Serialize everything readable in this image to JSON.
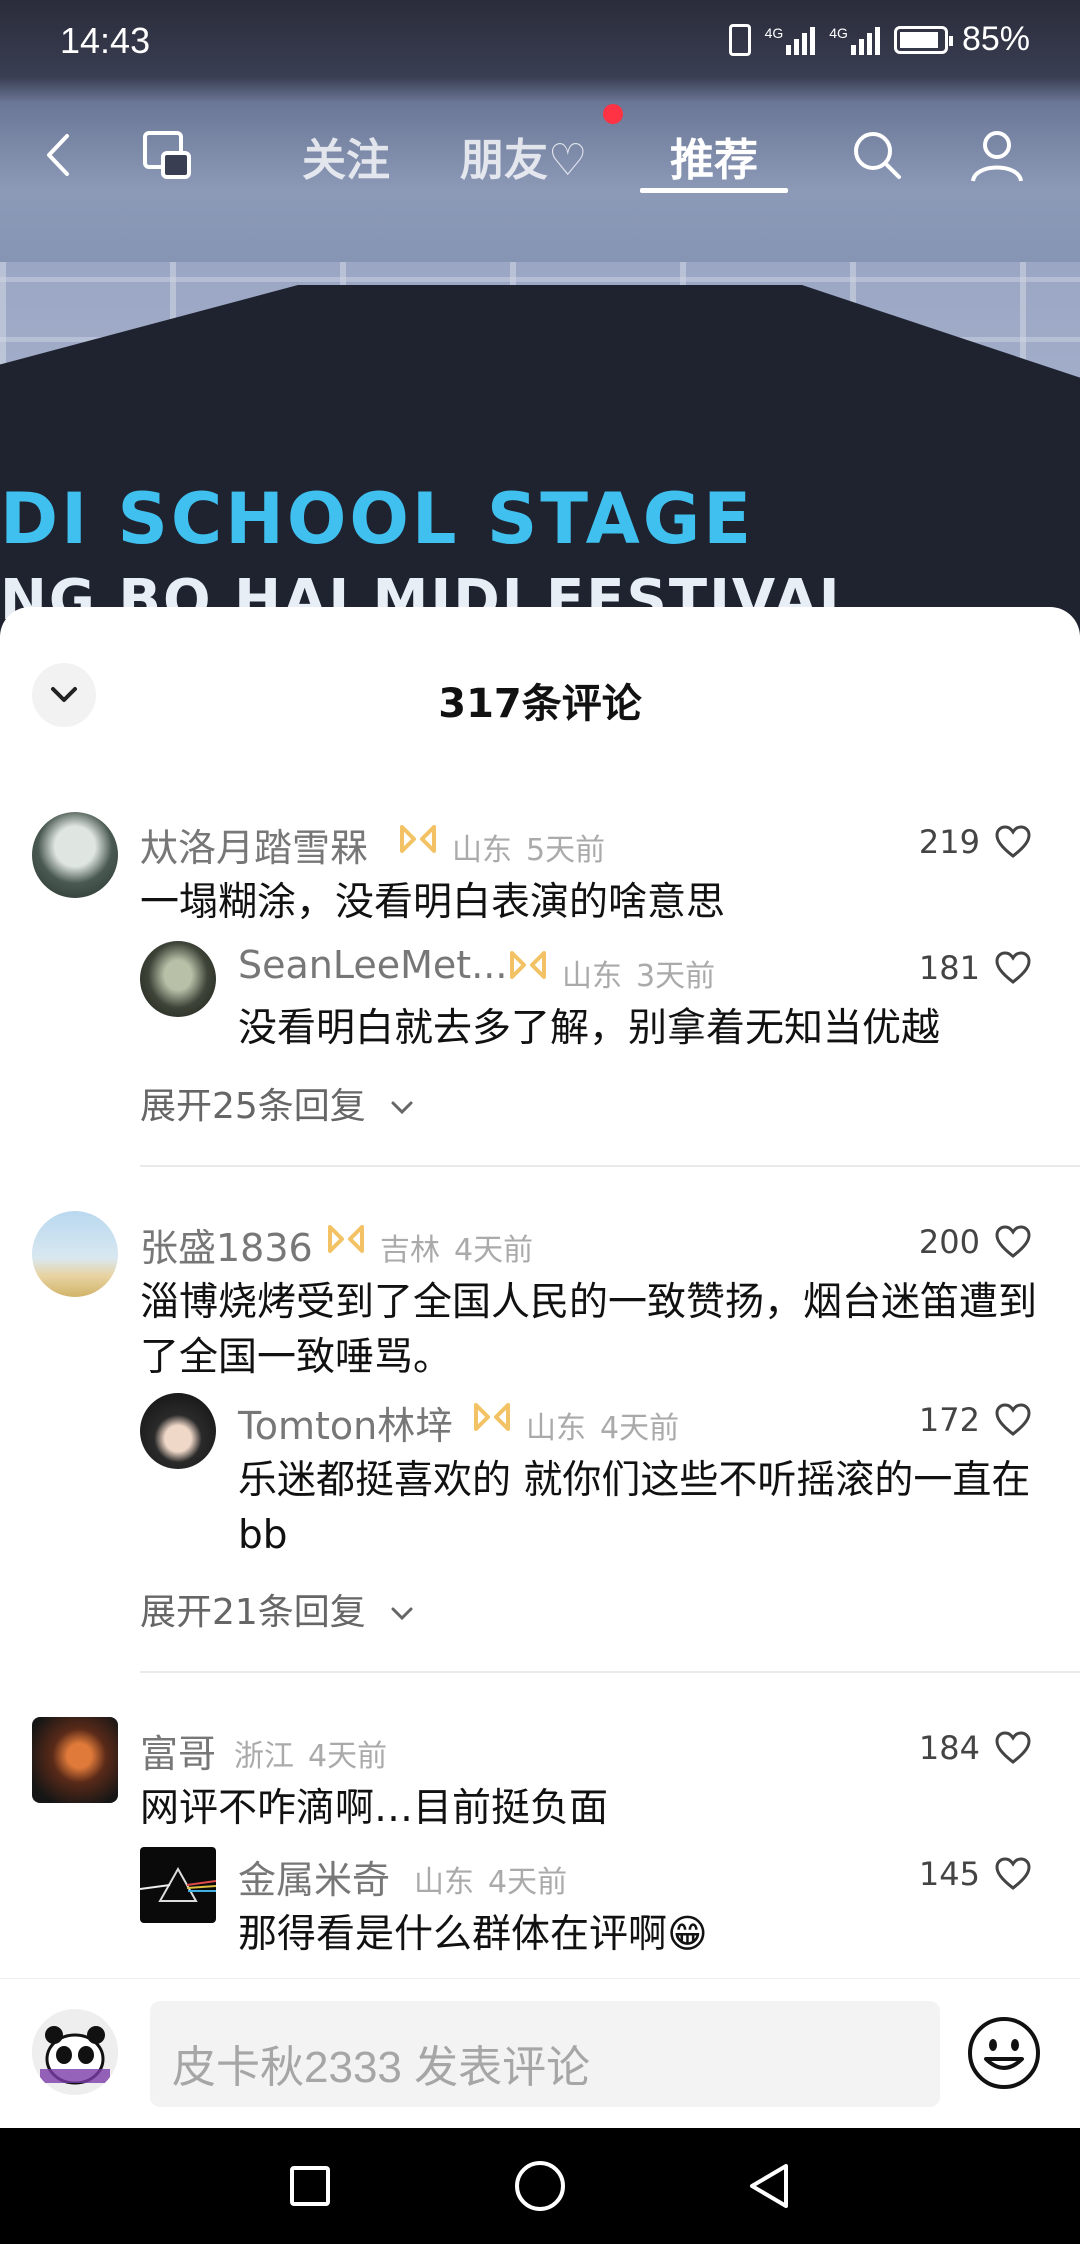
{
  "status_bar": {
    "time": "14:43",
    "network_1": "4G",
    "network_2": "4G",
    "battery": "85%"
  },
  "top_nav": {
    "tabs": [
      {
        "label": "关注"
      },
      {
        "label": "朋友♡"
      },
      {
        "label": "推荐",
        "active": true
      }
    ]
  },
  "video": {
    "text_line1": "DI SCHOOL STAGE",
    "text_line2": "NG BO HAI MIDI FESTIVAL"
  },
  "comments_sheet": {
    "title": "317条评论",
    "threads": [
      {
        "user": "夶洛月踏雪槑",
        "region": "山东",
        "time": "5天前",
        "likes": "219",
        "text": "一塌糊涂，没看明白表演的啥意思",
        "reply": {
          "user": "SeanLeeMet...",
          "region": "山东",
          "time": "3天前",
          "likes": "181",
          "text": "没看明白就去多了解，别拿着无知当优越"
        },
        "expand": "展开25条回复"
      },
      {
        "user": "张盛1836",
        "region": "吉林",
        "time": "4天前",
        "likes": "200",
        "text": "淄博烧烤受到了全国人民的一致赞扬，烟台迷笛遭到了全国一致唾骂。",
        "reply": {
          "user": "Tomton林垶",
          "region": "山东",
          "time": "4天前",
          "likes": "172",
          "text": "乐迷都挺喜欢的 就你们这些不听摇滚的一直在 bb"
        },
        "expand": "展开21条回复"
      },
      {
        "user": "富哥",
        "region": "浙江",
        "time": "4天前",
        "likes": "184",
        "text": "网评不咋滴啊…目前挺负面",
        "reply": {
          "user": "金属米奇",
          "region": "山东",
          "time": "4天前",
          "likes": "145",
          "text": "那得看是什么群体在评啊😁"
        }
      }
    ]
  },
  "input_bar": {
    "placeholder": "皮卡秋2333 发表评论"
  },
  "colors": {
    "accent_red": "#ff3344",
    "badge_gold": "#f2c264",
    "stage_blue": "#3fc0ef"
  },
  "icons": [
    "back-icon",
    "screen-icon",
    "search-icon",
    "profile-icon",
    "chevron-down-icon",
    "heart-icon",
    "badge-icon",
    "emoji-icon",
    "square-icon",
    "circle-icon",
    "triangle-back-icon"
  ]
}
